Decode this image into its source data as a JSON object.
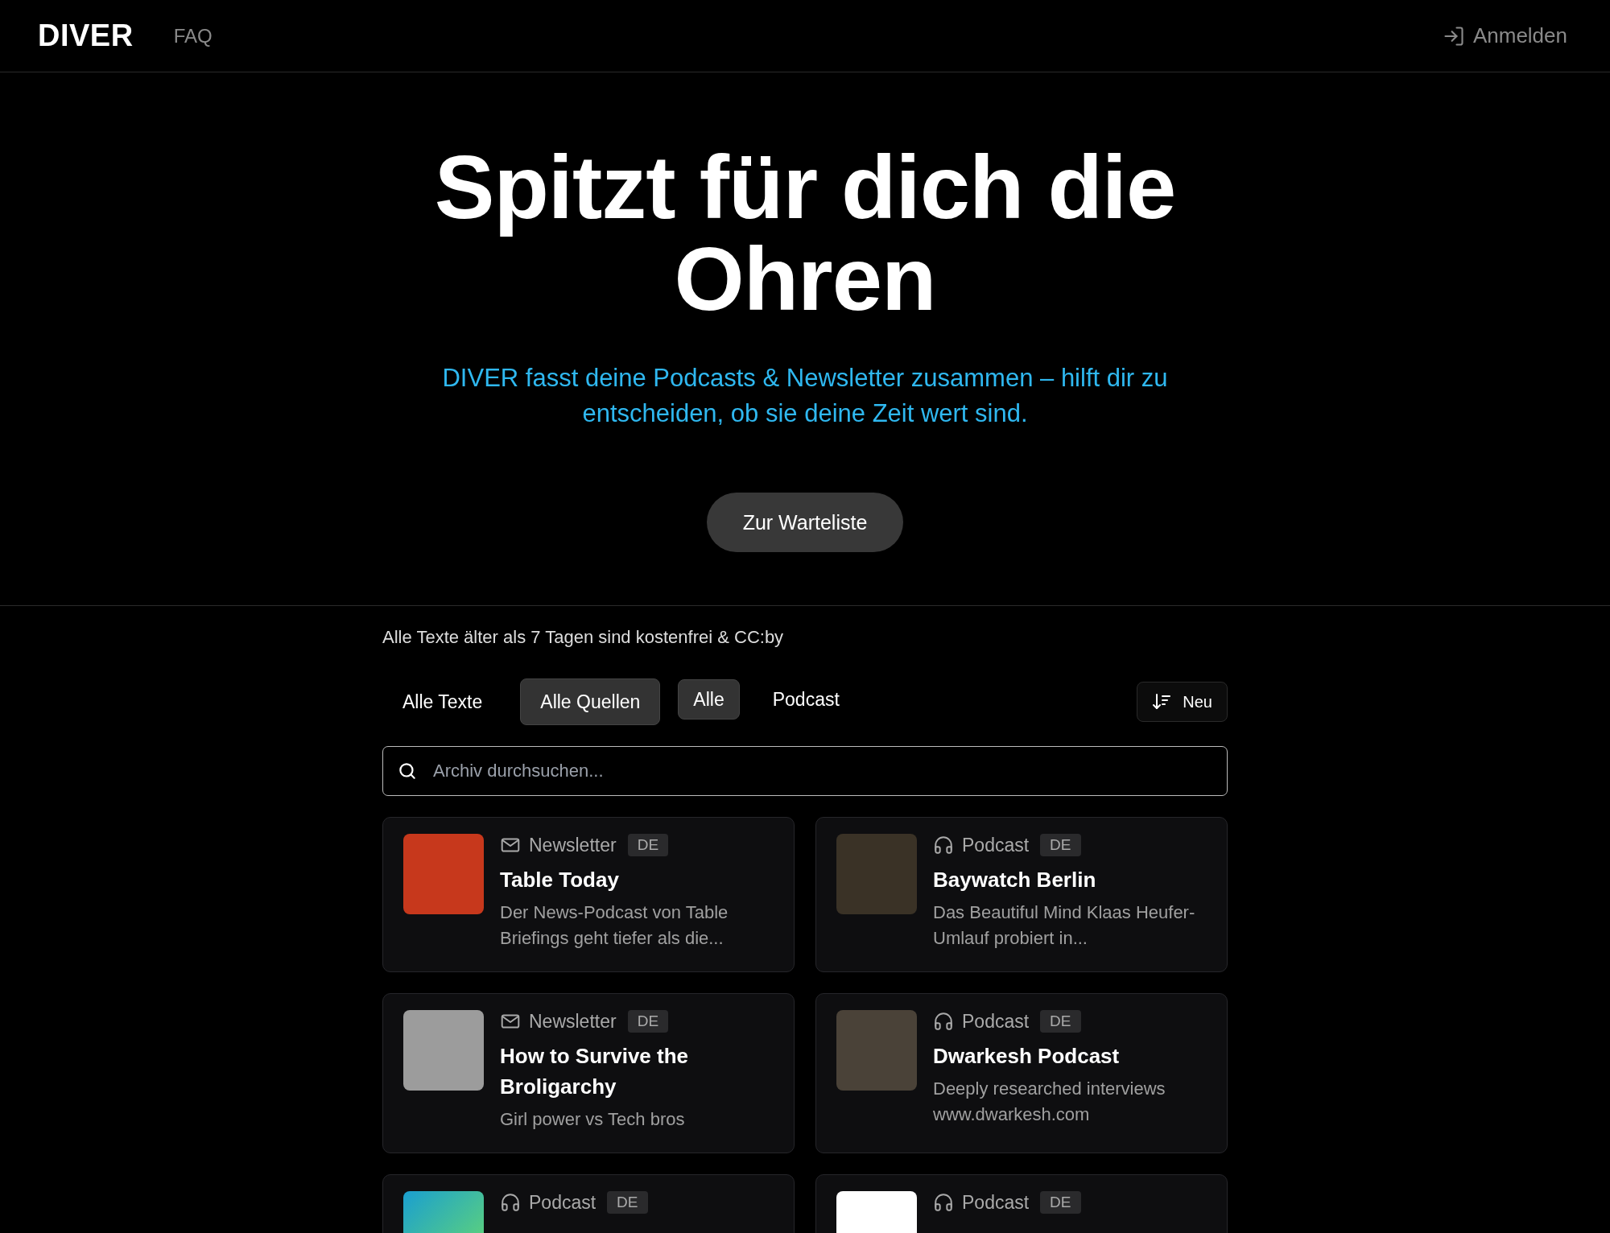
{
  "nav": {
    "logo": "DIVER",
    "links": [
      "FAQ"
    ],
    "login": "Anmelden"
  },
  "hero": {
    "title": "Spitzt für dich die Ohren",
    "subtitle": "DIVER fasst deine Podcasts & Newsletter zusammen – hilft dir zu entscheiden, ob sie deine Zeit wert sind.",
    "button": "Zur Warteliste"
  },
  "archive": {
    "note": "Alle Texte älter als 7 Tagen sind kostenfrei & CC:by",
    "source_tabs": [
      {
        "label": "Alle Texte",
        "selected": false
      },
      {
        "label": "Alle Quellen",
        "selected": true
      }
    ],
    "type_tabs": [
      {
        "label": "Alle",
        "selected": true
      },
      {
        "label": "Podcast",
        "selected": false
      }
    ],
    "sort": "Neu",
    "search": {
      "placeholder": "Archiv durchsuchen..."
    },
    "cards": [
      {
        "kind": "newsletter",
        "type": "Newsletter",
        "lang": "DE",
        "title": "Table Today",
        "description": "Der News-Podcast von Table Briefings geht tiefer als die..."
      },
      {
        "kind": "podcast",
        "type": "Podcast",
        "lang": "DE",
        "title": "Baywatch Berlin",
        "description": "Das Beautiful Mind Klaas Heufer-Umlauf probiert in..."
      },
      {
        "kind": "newsletter",
        "type": "Newsletter",
        "lang": "DE",
        "title": "How to Survive the Broligarchy",
        "description": "Girl power vs Tech bros"
      },
      {
        "kind": "podcast",
        "type": "Podcast",
        "lang": "DE",
        "title": "Dwarkesh Podcast",
        "description": "Deeply researched interviews www.dwarkesh.com"
      },
      {
        "kind": "podcast",
        "type": "Podcast",
        "lang": "DE"
      },
      {
        "kind": "podcast",
        "type": "Podcast",
        "lang": "DE"
      }
    ]
  }
}
